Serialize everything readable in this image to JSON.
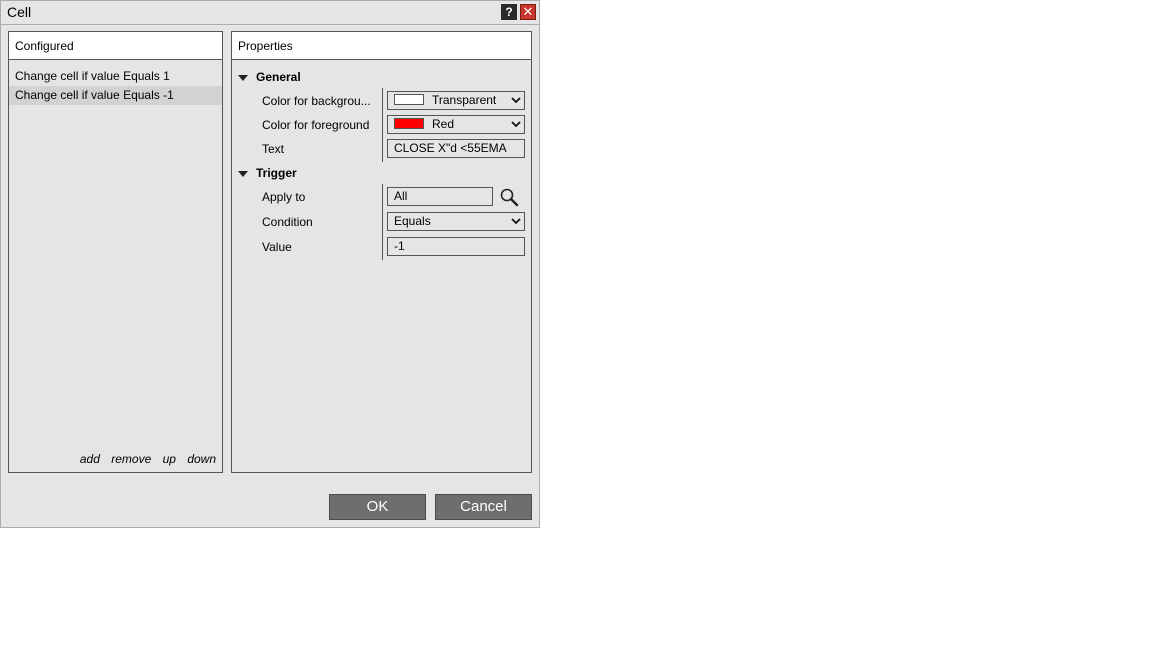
{
  "window": {
    "title": "Cell",
    "help_label": "?",
    "close_label": "✕"
  },
  "configured": {
    "header": "Configured",
    "items": [
      {
        "label": "Change cell if value Equals 1",
        "selected": false
      },
      {
        "label": "Change cell if value Equals -1",
        "selected": true
      }
    ],
    "links": {
      "add": "add",
      "remove": "remove",
      "up": "up",
      "down": "down"
    }
  },
  "properties": {
    "header": "Properties",
    "general": {
      "title": "General",
      "background_label": "Color for backgrou...",
      "background_value": "Transparent",
      "background_color": "#ffffff",
      "foreground_label": "Color for foreground",
      "foreground_value": "Red",
      "foreground_color": "#ff0000",
      "text_label": "Text",
      "text_value": "CLOSE X\"d <55EMA"
    },
    "trigger": {
      "title": "Trigger",
      "apply_to_label": "Apply to",
      "apply_to_value": "All",
      "apply_to_icon": "search-icon",
      "condition_label": "Condition",
      "condition_value": "Equals",
      "value_label": "Value",
      "value_value": "-1"
    }
  },
  "buttons": {
    "ok": "OK",
    "cancel": "Cancel"
  }
}
